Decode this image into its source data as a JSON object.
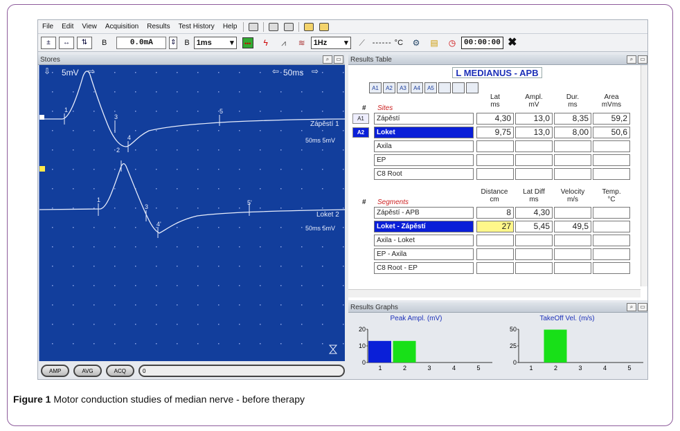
{
  "menu": {
    "items": [
      "File",
      "Edit",
      "View",
      "Acquisition",
      "Results",
      "Test History",
      "Help"
    ]
  },
  "toolbar": {
    "field_b1": "B",
    "current": "0.0mA",
    "field_b2": "B",
    "duration": "1ms",
    "freq": "1Hz",
    "temp_dashes": "------",
    "temp_unit": "°C",
    "timer": "00:00:00"
  },
  "stores": {
    "title": "Stores",
    "gain": "5mV",
    "sweep": "50ms",
    "trace1_label": "Zápěstí 1",
    "trace1_settings": "50ms 5mV",
    "trace2_label": "Loket 2",
    "trace2_settings": "50ms 5mV",
    "markers_trace1": [
      "1",
      "2",
      "3",
      "4",
      "5"
    ],
    "markers_trace2": [
      "1",
      "2",
      "3",
      "4'",
      "5'"
    ],
    "bottom_buttons": [
      "AMP",
      "AVG",
      "ACQ"
    ],
    "scroll_label": "0"
  },
  "results_table": {
    "title": "Results Table",
    "nerve": "L MEDIANUS - APB",
    "tabs": [
      "A1",
      "A2",
      "A3",
      "A4",
      "A5",
      "",
      "",
      ""
    ],
    "sites_header": {
      "hash": "#",
      "label": "Sites",
      "lat": [
        "Lat",
        "ms"
      ],
      "ampl": [
        "Ampl.",
        "mV"
      ],
      "dur": [
        "Dur.",
        "ms"
      ],
      "area": [
        "Area",
        "mVms"
      ]
    },
    "sites": [
      {
        "tag": "A1",
        "name": "Zápěstí",
        "lat": "4,30",
        "ampl": "13,0",
        "dur": "8,35",
        "area": "59,2"
      },
      {
        "tag": "A2",
        "name": "Loket",
        "lat": "9,75",
        "ampl": "13,0",
        "dur": "8,00",
        "area": "50,6"
      },
      {
        "tag": "",
        "name": "Axila",
        "lat": "",
        "ampl": "",
        "dur": "",
        "area": ""
      },
      {
        "tag": "",
        "name": "EP",
        "lat": "",
        "ampl": "",
        "dur": "",
        "area": ""
      },
      {
        "tag": "",
        "name": "C8 Root",
        "lat": "",
        "ampl": "",
        "dur": "",
        "area": ""
      }
    ],
    "segments_header": {
      "hash": "#",
      "label": "Segments",
      "distance": [
        "Distance",
        "cm"
      ],
      "latdiff": [
        "Lat Diff",
        "ms"
      ],
      "velocity": [
        "Velocity",
        "m/s"
      ],
      "temp": [
        "Temp.",
        "°C"
      ]
    },
    "segments": [
      {
        "name": "Zápěstí - APB",
        "distance": "8",
        "latdiff": "4,30",
        "velocity": "",
        "temp": ""
      },
      {
        "name": "Loket - Zápěstí",
        "distance": "27",
        "latdiff": "5,45",
        "velocity": "49,5",
        "temp": ""
      },
      {
        "name": "Axila - Loket",
        "distance": "",
        "latdiff": "",
        "velocity": "",
        "temp": ""
      },
      {
        "name": "EP - Axila",
        "distance": "",
        "latdiff": "",
        "velocity": "",
        "temp": ""
      },
      {
        "name": "C8 Root - EP",
        "distance": "",
        "latdiff": "",
        "velocity": "",
        "temp": ""
      }
    ]
  },
  "results_graphs": {
    "title": "Results Graphs"
  },
  "chart_data": [
    {
      "type": "bar",
      "title": "Peak Ampl. (mV)",
      "categories": [
        "1",
        "2",
        "3",
        "4",
        "5"
      ],
      "values": [
        13,
        13,
        null,
        null,
        null
      ],
      "colors": [
        "#0a1fd8",
        "#18e018"
      ],
      "ylim": [
        0,
        20
      ],
      "yticks": [
        "20",
        "10",
        "0"
      ]
    },
    {
      "type": "bar",
      "title": "TakeOff Vel. (m/s)",
      "categories": [
        "1",
        "2",
        "3",
        "4",
        "5"
      ],
      "values": [
        null,
        49.5,
        null,
        null,
        null
      ],
      "colors": [
        "#18e018"
      ],
      "ylim": [
        0,
        50
      ],
      "yticks": [
        "50",
        "25",
        "0"
      ]
    }
  ],
  "caption": {
    "figure": "Figure 1",
    "text": "Motor conduction studies of median nerve - before therapy"
  }
}
